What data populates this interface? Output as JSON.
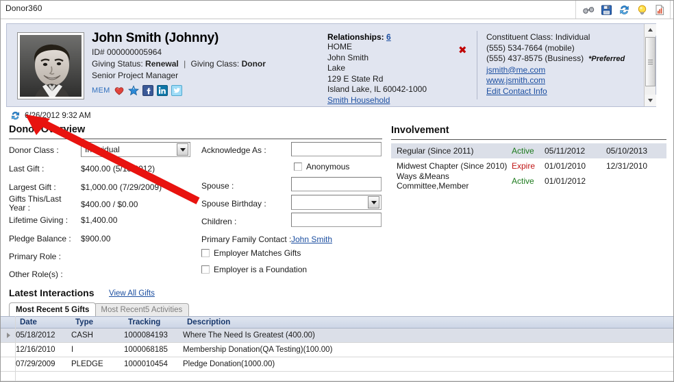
{
  "window": {
    "title": "Donor360"
  },
  "toolbar": {
    "icons": [
      {
        "name": "binoculars-icon",
        "label": "Search"
      },
      {
        "name": "save-icon",
        "label": "Save"
      },
      {
        "name": "refresh-icon",
        "label": "Refresh"
      },
      {
        "name": "lightbulb-icon",
        "label": "Tips"
      },
      {
        "name": "report-icon",
        "label": "Report"
      }
    ]
  },
  "summary": {
    "name": "John Smith (Johnny)",
    "id_line": "ID# 000000005964",
    "giving_status_label": "Giving Status:",
    "giving_status_value": "Renewal",
    "separator": "|",
    "giving_class_label": "Giving Class:",
    "giving_class_value": "Donor",
    "job_title": "Senior Project Manager",
    "mem_label": "MEM",
    "badges": [
      "heart-icon",
      "star-icon",
      "facebook-icon",
      "linkedin-icon",
      "twitter-icon"
    ],
    "relationships": {
      "heading": "Relationships:",
      "count": "6",
      "type": "HOME",
      "contact_name": "John Smith",
      "household_short": "Lake",
      "street": "129 E State Rd",
      "city_state_zip": "Island Lake, IL 60042-1000",
      "household_link": "Smith Household",
      "delete_glyph": "✖"
    },
    "contact": {
      "constituent_class": "Constituent Class: Individual",
      "phone_mobile": "(555) 534-7664 (mobile)",
      "phone_business": "(555) 437-8575 (Business)",
      "preferred_note": "*Preferred",
      "email": "jsmith@me.com",
      "website": "www.jsmith.com",
      "edit_link": "Edit Contact Info"
    }
  },
  "refresh": {
    "timestamp": "6/26/2012 9:32 AM"
  },
  "donor_overview": {
    "title": "Donor Overview",
    "fields": [
      {
        "label": "Donor Class :",
        "value": "Individual",
        "type": "dropdown"
      },
      {
        "label": "Last Gift :",
        "value": "$400.00 (5/18/2012)",
        "type": "text"
      },
      {
        "label": "Largest Gift :",
        "value": "$1,000.00 (7/29/2009)",
        "type": "text"
      },
      {
        "label": "Gifts This/Last Year :",
        "value": "$400.00 / $0.00",
        "type": "text"
      },
      {
        "label": "Lifetime Giving :",
        "value": "$1,400.00",
        "type": "text"
      },
      {
        "label": "Pledge Balance :",
        "value": "$900.00",
        "type": "text"
      },
      {
        "label": "Primary Role :",
        "value": "",
        "type": "text"
      },
      {
        "label": "Other Role(s) :",
        "value": "",
        "type": "text"
      }
    ],
    "labels": {
      "donor_class": "Donor Class :",
      "last_gift": "Last Gift :",
      "largest_gift": "Largest Gift :",
      "gifts_this_last_1": "Gifts This/Last",
      "gifts_this_last_2": "Year :",
      "lifetime_giving": "Lifetime Giving :",
      "pledge_balance": "Pledge Balance :",
      "primary_role": "Primary Role :",
      "other_roles": "Other Role(s) :"
    },
    "values": {
      "donor_class": "Individual",
      "last_gift": "$400.00 (5/18/2012)",
      "largest_gift": "$1,000.00 (7/29/2009)",
      "gifts_this_last": "$400.00 / $0.00",
      "lifetime_giving": "$1,400.00",
      "pledge_balance": "$900.00",
      "primary_role": "",
      "other_roles": ""
    },
    "middle": {
      "acknowledge_label": "Acknowledge As :",
      "acknowledge_value": "",
      "anonymous_label": "Anonymous",
      "anonymous_checked": false,
      "spouse_label": "Spouse :",
      "spouse_value": "",
      "spouse_birthday_label": "Spouse Birthday :",
      "spouse_birthday_value": "",
      "children_label": "Children :",
      "children_value": "",
      "primary_family_contact_label": "Primary Family Contact :",
      "primary_family_contact_link": "John Smith",
      "employer_matches_label": "Employer Matches Gifts",
      "employer_matches_checked": false,
      "employer_foundation_label": "Employer is a Foundation",
      "employer_foundation_checked": false
    }
  },
  "involvement": {
    "title": "Involvement",
    "rows": [
      {
        "name": "Regular (Since 2011)",
        "status": "Active",
        "status_kind": "active",
        "start": "05/11/2012",
        "end": "05/10/2013",
        "selected": true
      },
      {
        "name": "Midwest Chapter (Since 2010)",
        "status": "Expire",
        "status_kind": "expire",
        "start": "01/01/2010",
        "end": "12/31/2010",
        "selected": false
      },
      {
        "name": "Ways &Means Committee,Member",
        "status": "Active",
        "status_kind": "active",
        "start": "01/01/2012",
        "end": "",
        "selected": false
      }
    ]
  },
  "latest_interactions": {
    "title": "Latest Interactions",
    "view_all_link": "View All Gifts",
    "tabs": [
      {
        "label": "Most Recent 5 Gifts",
        "active": true
      },
      {
        "label": "Most Recent5 Activities",
        "active": false
      }
    ],
    "columns": [
      "Date",
      "Type",
      "Tracking",
      "Description"
    ],
    "rows": [
      {
        "date": "05/18/2012",
        "type": "CASH",
        "tracking": "1000084193",
        "description": "Where The Need Is Greatest (400.00)",
        "selected": true
      },
      {
        "date": "12/16/2010",
        "type": "I",
        "tracking": "1000068185",
        "description": "Membership Donation(QA Testing)(100.00)",
        "selected": false
      },
      {
        "date": "07/29/2009",
        "type": "PLEDGE",
        "tracking": "1000010454",
        "description": "Pledge Donation(1000.00)",
        "selected": false
      }
    ]
  },
  "annotation": {
    "type": "arrow",
    "color": "#e8130f",
    "points_to": "refresh-icon"
  },
  "colors": {
    "panel_bg": "#e1e5f0",
    "link": "#1b4ea0",
    "active_status": "#1c7a1c",
    "expire_status": "#c01414",
    "grid_header": "#cdd6e6",
    "selected_row": "#dbdfe8",
    "annotation": "#e8130f"
  }
}
